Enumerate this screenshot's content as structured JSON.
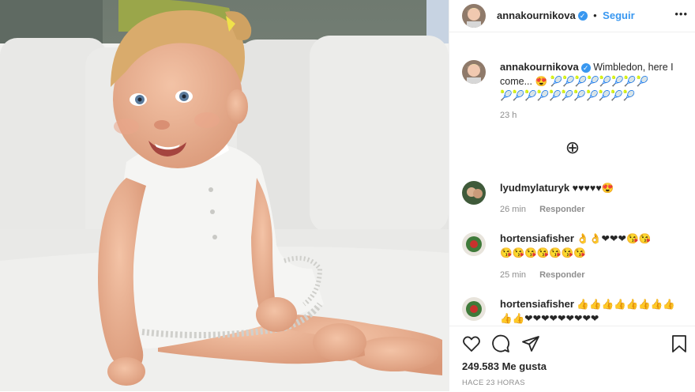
{
  "post": {
    "author": "annakournikova",
    "follow_label": "Seguir",
    "more_label": "•••",
    "caption": "Wimbledon, here I come...",
    "caption_emojis_line1": "😍 🎾🎾🎾🎾🎾🎾🎾🎾",
    "caption_emojis_line2": "🎾🎾🎾🎾🎾🎾🎾🎾🎾🎾🎾",
    "time": "23 h",
    "load_more_label": "⊕",
    "likes": "249.583 Me gusta",
    "posted_ago": "HACE 23 HORAS"
  },
  "comments": [
    {
      "user": "lyudmylaturyk",
      "text": "♥♥♥♥♥😍",
      "time": "26 min",
      "reply_label": "Responder"
    },
    {
      "user": "hortensiafisher",
      "line1": "👌👌❤❤❤😘😘",
      "line2": "😘😘😘😘😘😘😘",
      "time": "25 min",
      "reply_label": "Responder"
    },
    {
      "user": "hortensiafisher",
      "line1": "👍👍👍👍👍👍👍👍",
      "line2": "👍👍❤❤❤❤❤❤❤❤❤"
    }
  ],
  "colors": {
    "accent": "#3897f0",
    "text": "#262626",
    "muted": "#8e8e8e"
  }
}
